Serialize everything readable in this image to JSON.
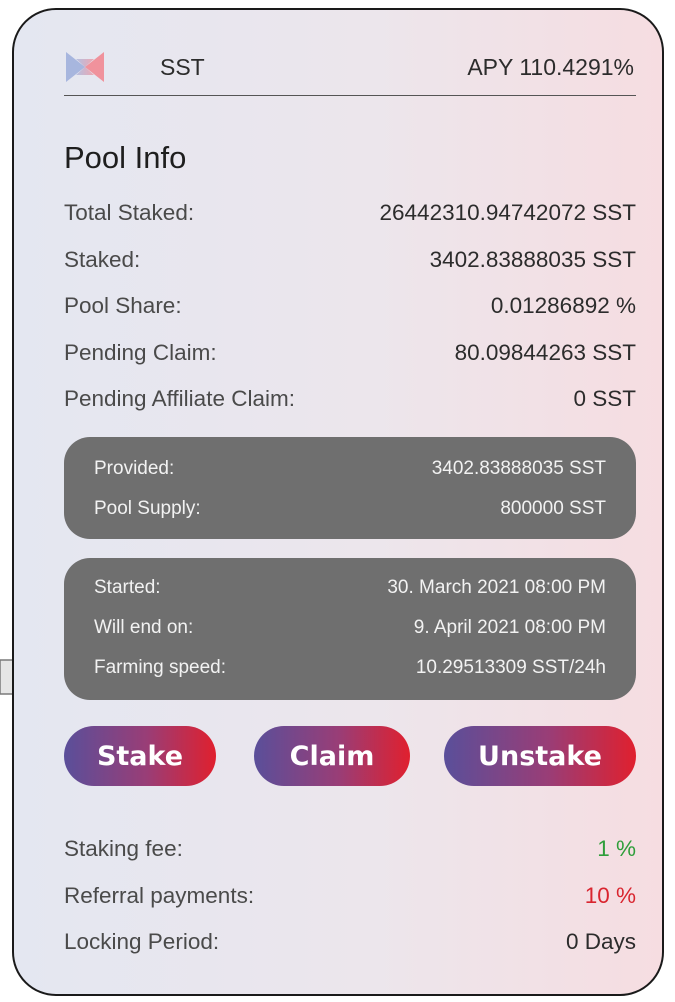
{
  "header": {
    "token": "SST",
    "apy": "APY 110.4291%"
  },
  "pool_info": {
    "title": "Pool Info",
    "rows": [
      {
        "label": "Total Staked:",
        "value": "26442310.94742072 SST"
      },
      {
        "label": "Staked:",
        "value": "3402.83888035 SST"
      },
      {
        "label": "Pool Share:",
        "value": "0.01286892 %"
      },
      {
        "label": "Pending Claim:",
        "value": "80.09844263 SST"
      },
      {
        "label": "Pending Affiliate Claim:",
        "value": "0 SST"
      }
    ]
  },
  "supply_panel": {
    "rows": [
      {
        "label": "Provided:",
        "value": "3402.83888035 SST"
      },
      {
        "label": "Pool Supply:",
        "value": "800000 SST"
      }
    ]
  },
  "timing_panel": {
    "rows": [
      {
        "label": "Started:",
        "value": "30. March 2021 08:00 PM"
      },
      {
        "label": "Will end on:",
        "value": "9. April 2021 08:00 PM"
      },
      {
        "label": "Farming speed:",
        "value": "10.29513309 SST/24h"
      }
    ]
  },
  "actions": {
    "stake": "Stake",
    "claim": "Claim",
    "unstake": "Unstake"
  },
  "fees": {
    "rows": [
      {
        "label": "Staking fee:",
        "value": "1 %",
        "color": "#2e9e3a"
      },
      {
        "label": "Referral payments:",
        "value": "10 %",
        "color": "#d9252f"
      },
      {
        "label": "Locking Period:",
        "value": "0 Days"
      }
    ]
  },
  "colors": {
    "button_gradient_start": "#5a4f9a",
    "button_gradient_end": "#e0202e",
    "panel_bg": "#6f6f6f"
  },
  "icons": {
    "logo": "sst-logo-icon",
    "pointer": "pointer-arrow-icon"
  }
}
